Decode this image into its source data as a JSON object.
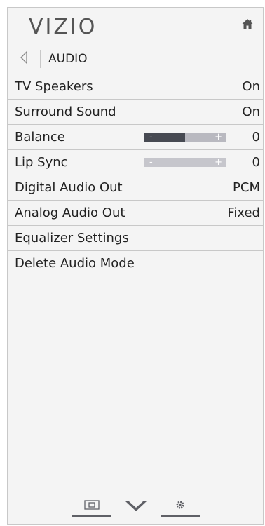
{
  "header": {
    "logo_text": "VIZIO",
    "home_icon": "home-icon"
  },
  "breadcrumb": {
    "back_icon": "back-arrow-icon",
    "title": "AUDIO"
  },
  "menu": {
    "items": [
      {
        "label": "TV Speakers",
        "value": "On"
      },
      {
        "label": "Surround Sound",
        "value": "On"
      },
      {
        "label": "Balance",
        "value": "0",
        "slider": {
          "level": 0.5,
          "minus": "-",
          "plus": "+"
        }
      },
      {
        "label": "Lip Sync",
        "value": "0",
        "slider": {
          "level": 0.0,
          "minus": "-",
          "plus": "+"
        }
      },
      {
        "label": "Digital Audio Out",
        "value": "PCM"
      },
      {
        "label": "Analog Audio Out",
        "value": "Fixed"
      },
      {
        "label": "Equalizer Settings",
        "value": ""
      },
      {
        "label": "Delete Audio Mode",
        "value": ""
      }
    ]
  },
  "bottom_nav": {
    "icons": [
      "picture-size-icon",
      "chevron-down-icon",
      "gear-icon"
    ]
  },
  "colors": {
    "panel_bg": "#f4f4f4",
    "divider": "#c8c8c8",
    "text": "#222222",
    "slider_track": "#b9b9c0",
    "slider_fill": "#474a52"
  }
}
